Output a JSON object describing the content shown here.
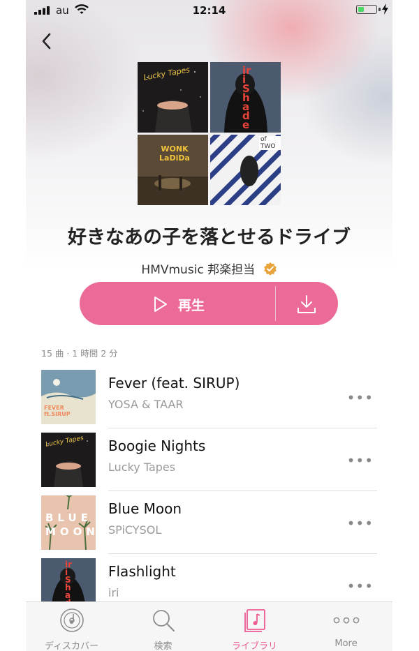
{
  "status_bar": {
    "carrier": "au",
    "time": "12:14"
  },
  "playlist": {
    "title": "好きなあの子を落とせるドライブ",
    "curator": "HMVmusic 邦楽担当",
    "play_label": "再生",
    "meta": "15 曲 · 1 時間 2 分",
    "cover_texts": {
      "tile1": "Lucky Tapes",
      "tile2": "iri Shade",
      "tile3": "WONK LaDiDa",
      "tile4": "of TWO"
    }
  },
  "tracks": [
    {
      "title": "Fever (feat. SIRUP)",
      "artist": "YOSA & TAAR",
      "art_text": "FEVER ft.SIRUP"
    },
    {
      "title": "Boogie Nights",
      "artist": "Lucky Tapes",
      "art_text": "Lucky Tapes"
    },
    {
      "title": "Blue Moon",
      "artist": "SPiCYSOL",
      "art_text": "BLUE MOON"
    },
    {
      "title": "Flashlight",
      "artist": "iri",
      "art_text": "iri Shade"
    }
  ],
  "more_symbol": "•••",
  "tabs": [
    {
      "label": "ディスカバー",
      "icon": "disc-icon"
    },
    {
      "label": "検索",
      "icon": "search-icon"
    },
    {
      "label": "ライブラリ",
      "icon": "library-icon"
    },
    {
      "label": "More",
      "icon": "more-icon"
    }
  ],
  "colors": {
    "accent": "#ec6a98",
    "active_tab": "#ec5a92",
    "verified": "#e8a33a"
  }
}
